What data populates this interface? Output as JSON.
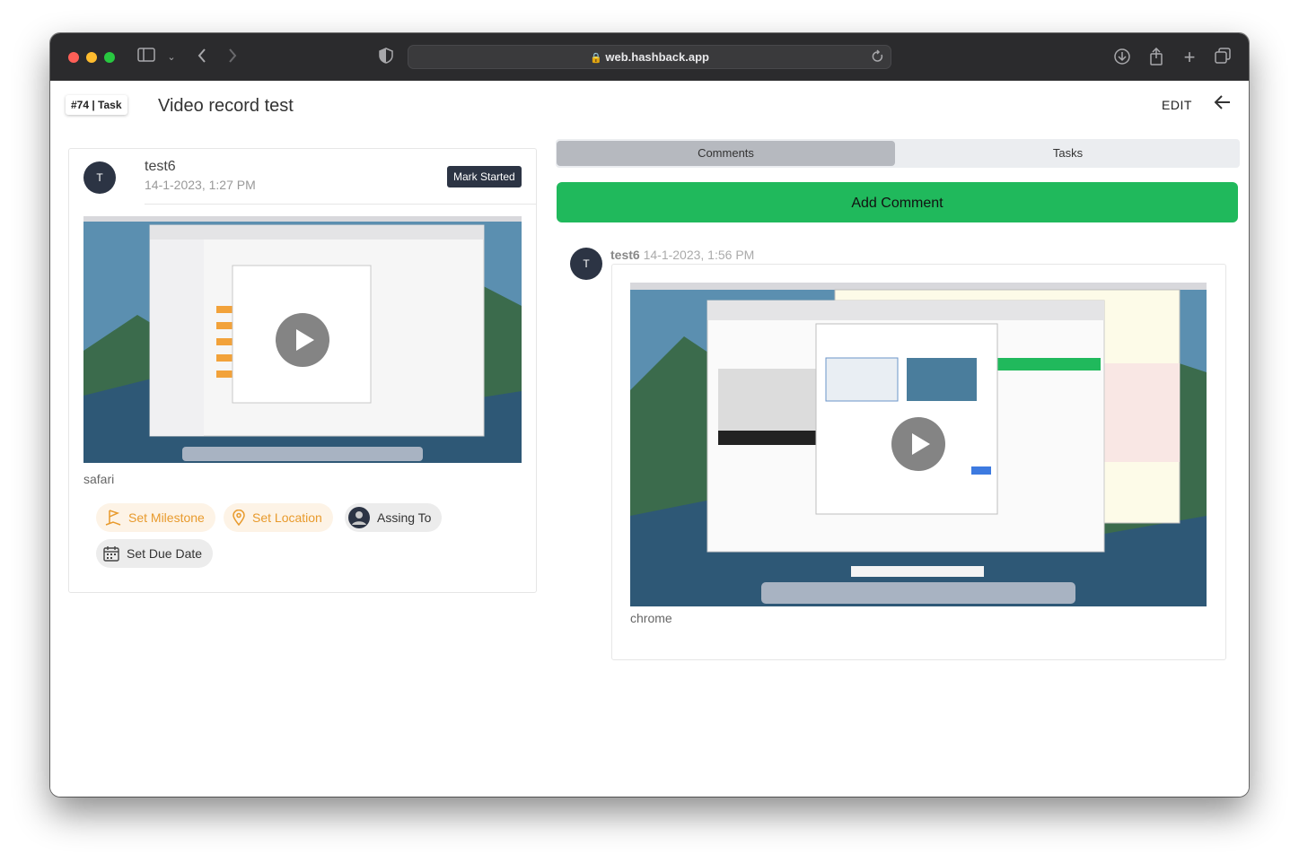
{
  "browser": {
    "url": "web.hashback.app"
  },
  "header": {
    "badge": "#74 | Task",
    "title": "Video record test",
    "edit_label": "EDIT"
  },
  "post": {
    "avatar_initial": "T",
    "user": "test6",
    "date": "14-1-2023, 1:27 PM",
    "status_button": "Mark Started",
    "caption": "safari",
    "actions": {
      "milestone": "Set Milestone",
      "location": "Set Location",
      "assign": "Assing To",
      "due_date": "Set Due Date"
    }
  },
  "tabs": {
    "comments": "Comments",
    "tasks": "Tasks"
  },
  "add_comment_label": "Add Comment",
  "comment": {
    "avatar_initial": "T",
    "user": "test6",
    "date": "14-1-2023, 1:56 PM",
    "caption": "chrome"
  },
  "colors": {
    "accent_green": "#20b95c",
    "dark": "#2c3444",
    "orange": "#e89a2c",
    "chip_orange_bg": "#fdf3e6",
    "chip_gray_bg": "#ececec"
  }
}
